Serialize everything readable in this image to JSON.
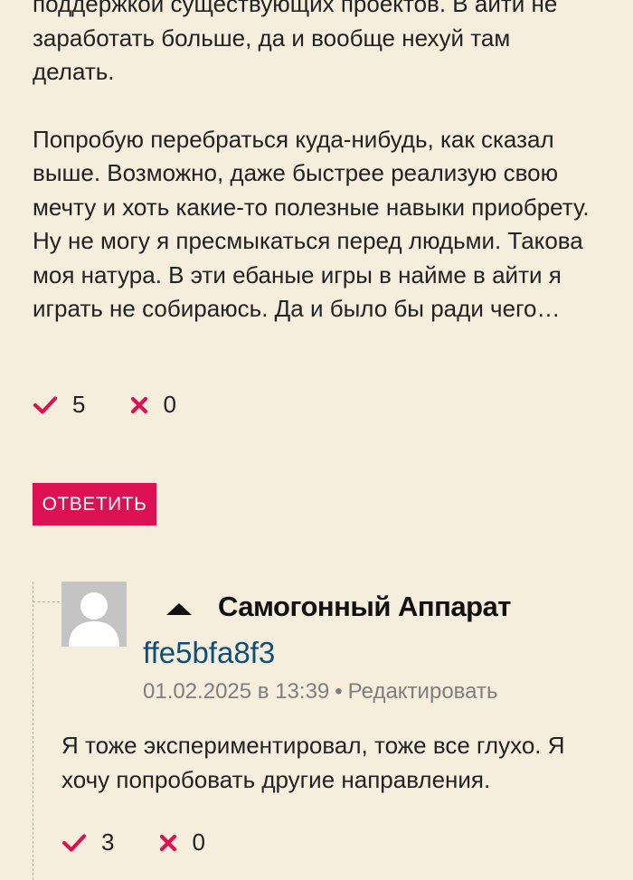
{
  "post": {
    "paragraphs": [
      "поддержкой существующих проектов. В айти не заработать больше, да и вообще нехуй там делать.",
      "Попробую перебраться куда-нибудь, как сказал выше. Возможно, даже быстрее реализую свою мечту и хоть какие-то полезные навыки приобрету. Ну не могу я пресмыкаться перед людьми. Такова моя натура. В эти ебаные игры в найме в айти я играть не собираюсь. Да и было бы ради чего…"
    ],
    "upvotes": "5",
    "downvotes": "0"
  },
  "reply_button": {
    "label": "ОТВЕТИТЬ"
  },
  "comment": {
    "author": "Самогонный Аппарат",
    "user_link": "ffe5bfa8f3",
    "date": "01.02.2025 в 13:39",
    "separator": "•",
    "edit_label": "Редактировать",
    "text": "Я тоже экспериментировал, тоже все глухо. Я хочу попробовать другие направления.",
    "upvotes": "3",
    "downvotes": "0"
  },
  "colors": {
    "background": "#f6eedc",
    "accent": "#dc1154",
    "link": "#0d4f7a",
    "meta": "#7e7e7e"
  },
  "icons": {
    "upvote": "check-icon",
    "downvote": "cross-icon",
    "collapse": "caret-up-icon",
    "avatar": "default-user-avatar"
  }
}
